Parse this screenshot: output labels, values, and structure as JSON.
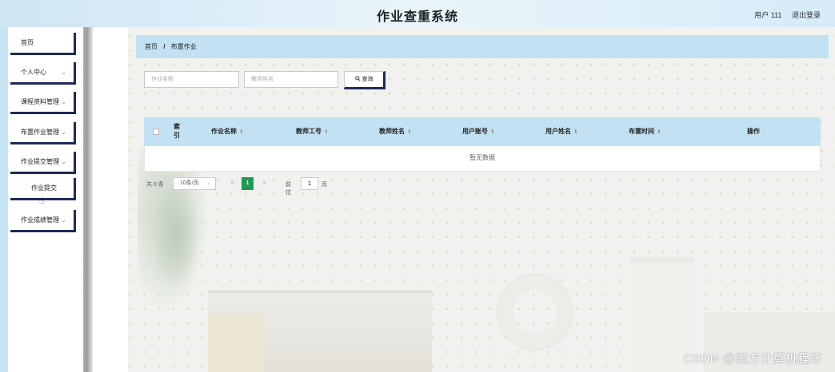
{
  "header": {
    "title": "作业查重系统",
    "user_label": "用户 111",
    "logout_label": "退出登录"
  },
  "sidebar": {
    "items": [
      {
        "label": "首页",
        "has_arrow": false
      },
      {
        "label": "个人中心",
        "has_arrow": true
      },
      {
        "label": "课程资料管理",
        "has_arrow": true
      },
      {
        "label": "布置作业管理",
        "has_arrow": true
      },
      {
        "label": "作业提交管理",
        "has_arrow": true
      },
      {
        "label": "作业提交",
        "has_arrow": false,
        "submenu": true
      },
      {
        "label": "作业成绩管理",
        "has_arrow": true
      }
    ],
    "arrow_glyph": "⌄"
  },
  "breadcrumb": {
    "home": "首页",
    "separator": "/",
    "current": "布置作业"
  },
  "search": {
    "name_placeholder": "作业名称",
    "teacher_placeholder": "教师姓名",
    "button_label": "查询",
    "button_icon": "search-icon"
  },
  "table": {
    "columns": [
      "索引",
      "作业名称",
      "教师工号",
      "教师姓名",
      "用户账号",
      "用户姓名",
      "布置时间",
      "操作"
    ],
    "sortable": [
      false,
      true,
      true,
      true,
      true,
      true,
      true,
      false
    ],
    "empty_text": "暂无数据"
  },
  "pagination": {
    "total_text": "共 0 条",
    "page_size": "10条/页",
    "prev": "<",
    "current_page": "1",
    "next": ">",
    "goto_label": "前往",
    "goto_value": "1",
    "page_unit": "页"
  },
  "watermark": "CSDN @南方计算机程序",
  "colors": {
    "header_bg": "#cfe6f4",
    "table_header_bg": "#c2e1f2",
    "accent_border": "#1e2a5a",
    "page_active": "#1b9b57"
  }
}
